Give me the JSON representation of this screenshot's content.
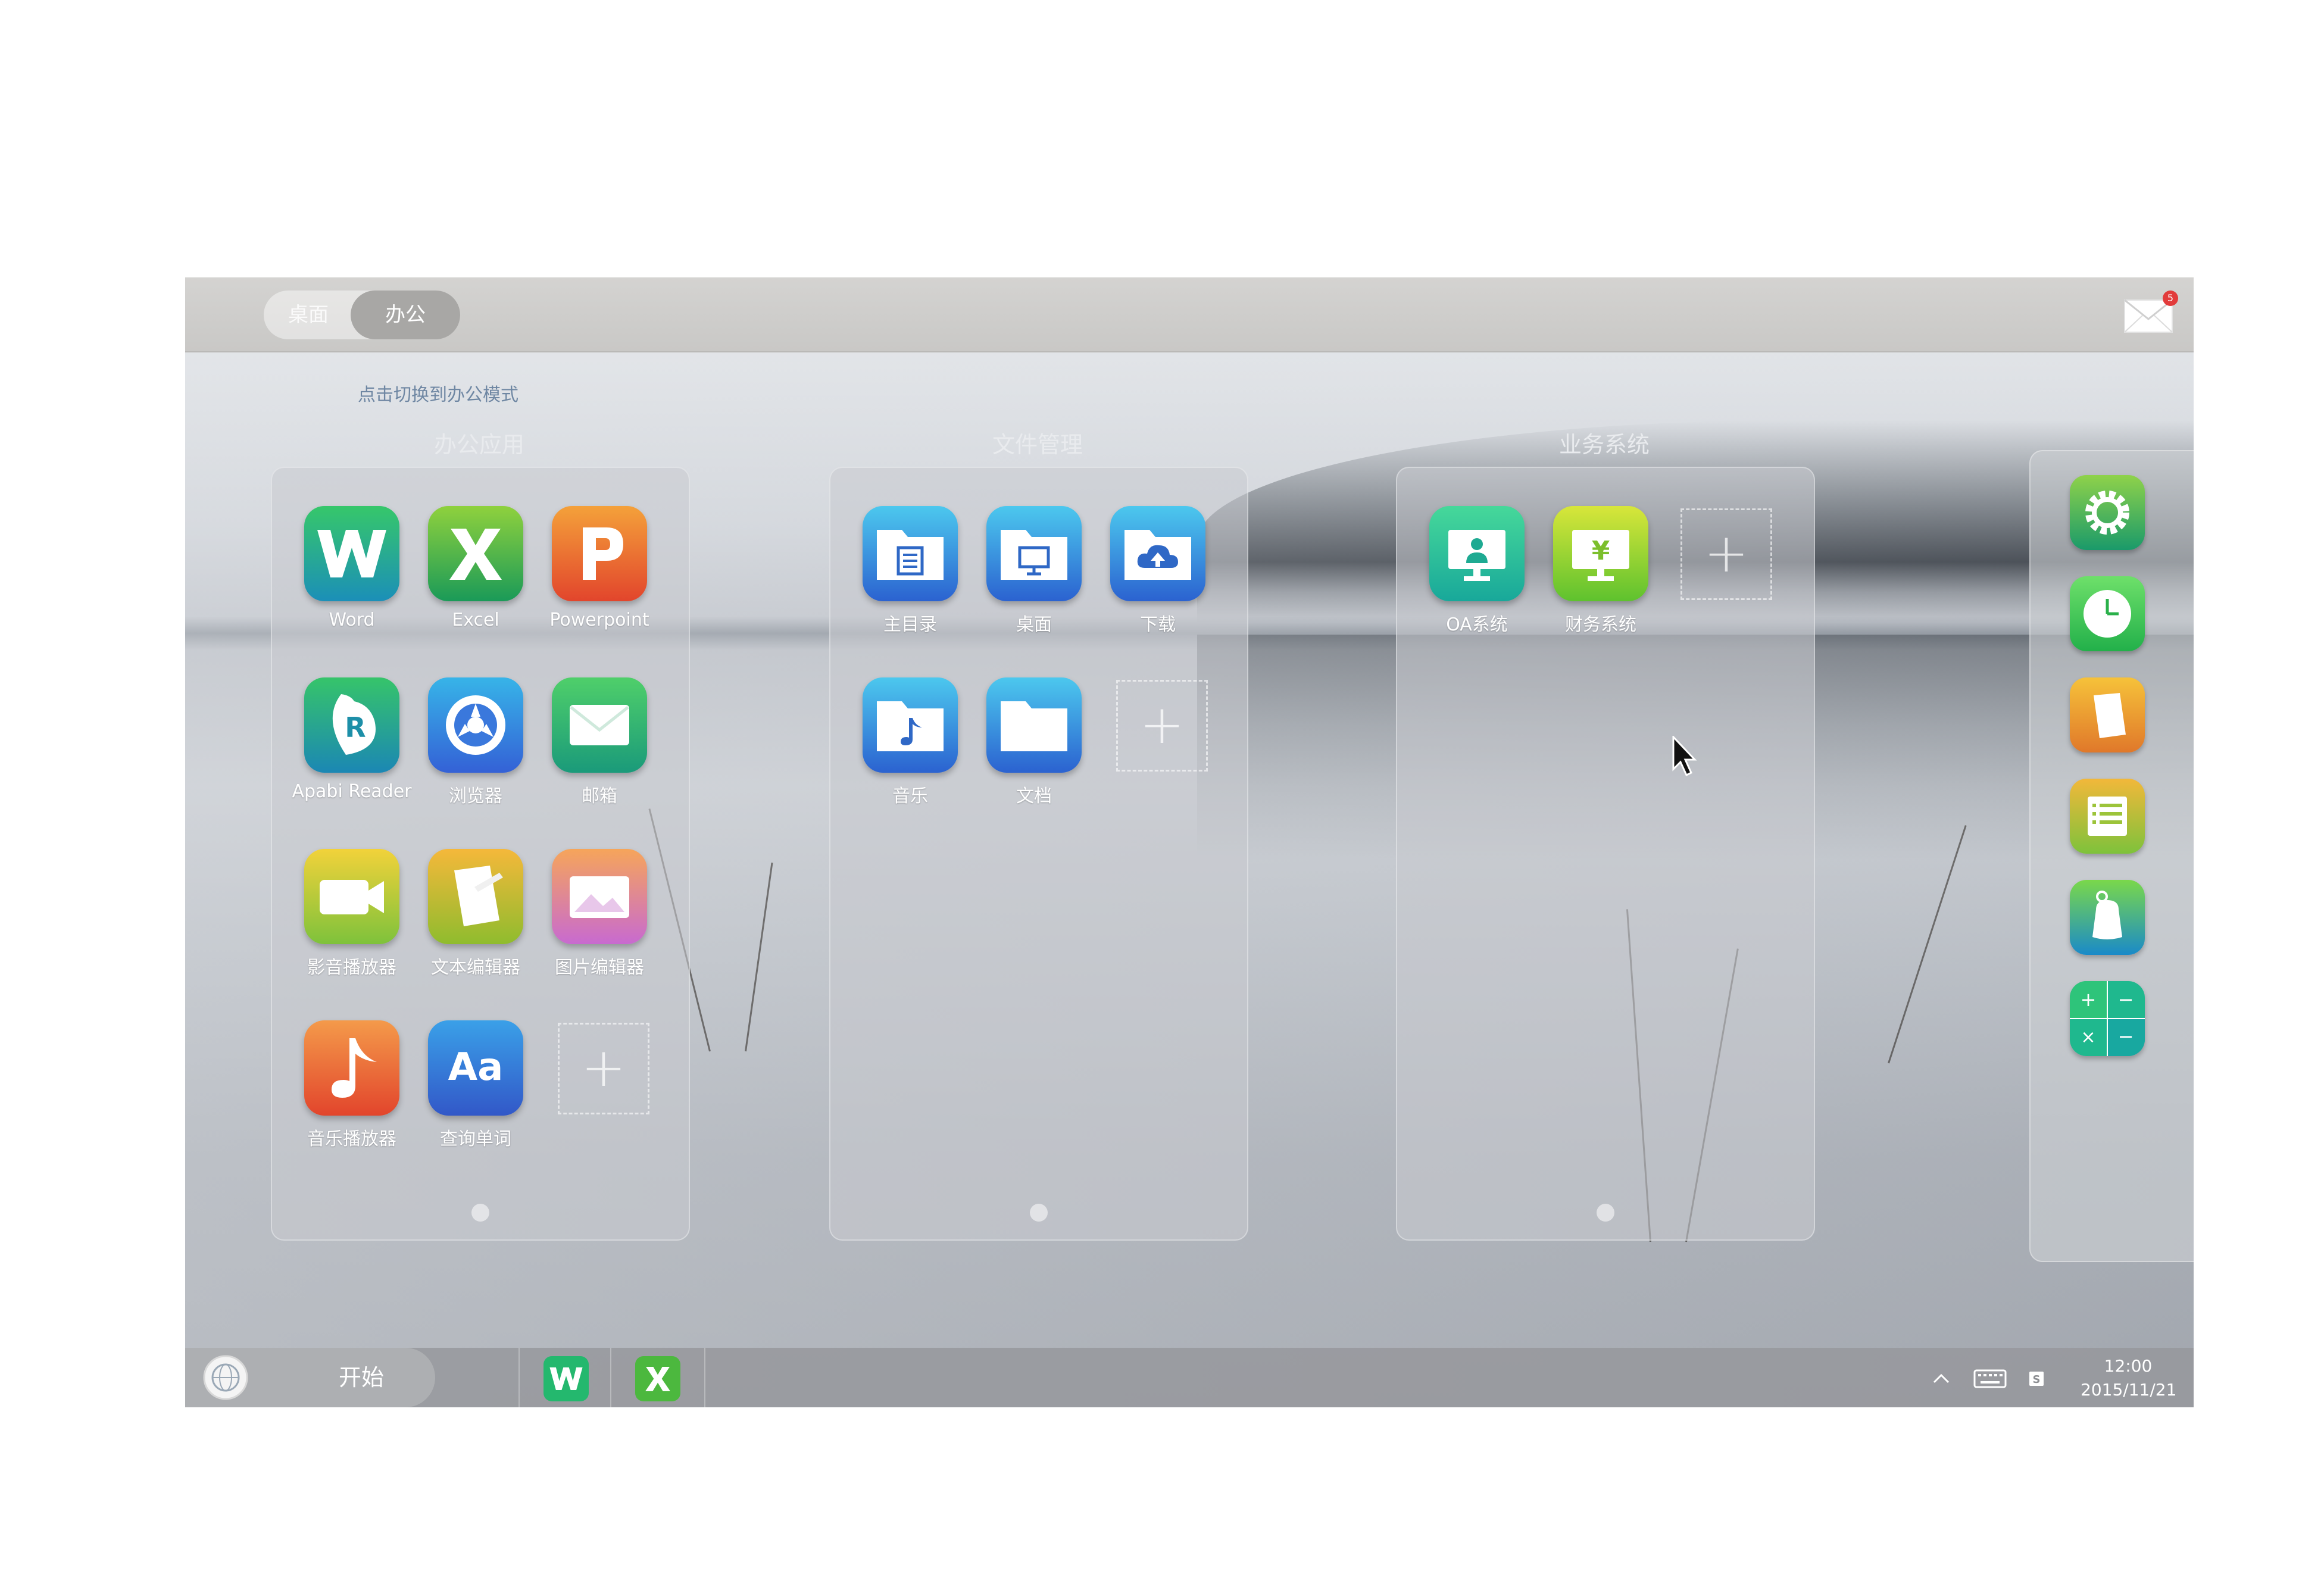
{
  "topbar": {
    "mode_desktop": "桌面",
    "mode_office": "办公",
    "mail_badge": "5",
    "hint": "点击切换到办公模式"
  },
  "panels": [
    {
      "title": "办公应用",
      "apps": [
        {
          "label": "Word",
          "icon": "word-icon"
        },
        {
          "label": "Excel",
          "icon": "excel-icon"
        },
        {
          "label": "Powerpoint",
          "icon": "powerpoint-icon"
        },
        {
          "label": "Apabi Reader",
          "icon": "apabi-reader-icon"
        },
        {
          "label": "浏览器",
          "icon": "browser-icon"
        },
        {
          "label": "邮箱",
          "icon": "mail-icon"
        },
        {
          "label": "影音播放器",
          "icon": "video-player-icon"
        },
        {
          "label": "文本编辑器",
          "icon": "text-editor-icon"
        },
        {
          "label": "图片编辑器",
          "icon": "image-editor-icon"
        },
        {
          "label": "音乐播放器",
          "icon": "music-player-icon"
        },
        {
          "label": "查询单词",
          "icon": "dictionary-icon"
        }
      ]
    },
    {
      "title": "文件管理",
      "apps": [
        {
          "label": "主目录",
          "icon": "home-folder-icon"
        },
        {
          "label": "桌面",
          "icon": "desktop-folder-icon"
        },
        {
          "label": "下载",
          "icon": "download-folder-icon"
        },
        {
          "label": "音乐",
          "icon": "music-folder-icon"
        },
        {
          "label": "文档",
          "icon": "documents-folder-icon"
        }
      ]
    },
    {
      "title": "业务系统",
      "apps": [
        {
          "label": "OA系统",
          "icon": "oa-system-icon"
        },
        {
          "label": "财务系统",
          "icon": "finance-system-icon"
        }
      ]
    }
  ],
  "dock": [
    "settings-icon",
    "clock-icon",
    "notes-icon",
    "list-icon",
    "cleaner-icon",
    "calculator-icon"
  ],
  "taskbar": {
    "start_label": "开始",
    "apps": [
      "word-icon",
      "excel-icon"
    ],
    "time": "12:00",
    "date": "2015/11/21"
  },
  "colors": {
    "topbar": "#cbcac8",
    "hint_text": "#6f87a3",
    "badge": "#e23b3b"
  }
}
